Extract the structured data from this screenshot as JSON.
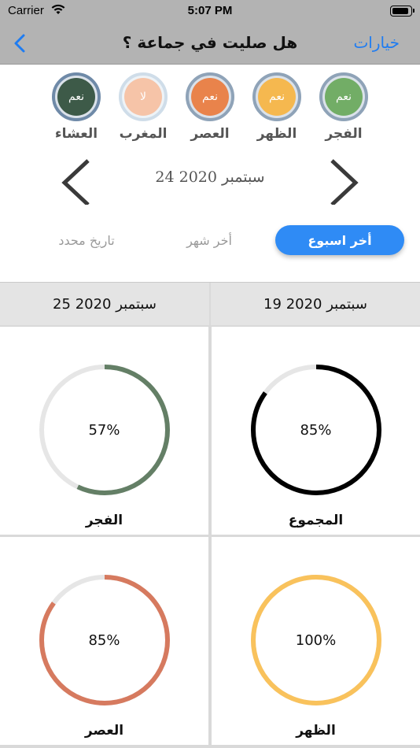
{
  "status_bar": {
    "carrier": "Carrier",
    "time": "5:07 PM"
  },
  "nav": {
    "title": "هل صليت في جماعة ؟",
    "options_label": "خيارات"
  },
  "prayers": [
    {
      "name": "الفجر",
      "status": "نعم",
      "color": "#72ad66"
    },
    {
      "name": "الظهر",
      "status": "نعم",
      "color": "#f5b84f"
    },
    {
      "name": "العصر",
      "status": "نعم",
      "color": "#e9834b"
    },
    {
      "name": "المغرب",
      "status": "لا",
      "color": "#f6c4a8"
    },
    {
      "name": "العشاء",
      "status": "نعم",
      "color": "#3d5a48"
    }
  ],
  "date_nav": {
    "date": "24 سبتمبر 2020"
  },
  "segments": {
    "last_week": "أخر اسبوع",
    "last_month": "أخر شهر",
    "specific_date": "تاريخ محدد"
  },
  "range": {
    "from": "19 سبتمبر 2020",
    "to": "25 سبتمبر 2020"
  },
  "stats": [
    {
      "label": "المجموع",
      "percent_text": "85%",
      "value": 85,
      "color": "#000000"
    },
    {
      "label": "الفجر",
      "percent_text": "57%",
      "value": 57,
      "color": "#647f66"
    },
    {
      "label": "الظهر",
      "percent_text": "100%",
      "value": 100,
      "color": "#f9c25c"
    },
    {
      "label": "العصر",
      "percent_text": "85%",
      "value": 85,
      "color": "#d67a5f"
    }
  ]
}
